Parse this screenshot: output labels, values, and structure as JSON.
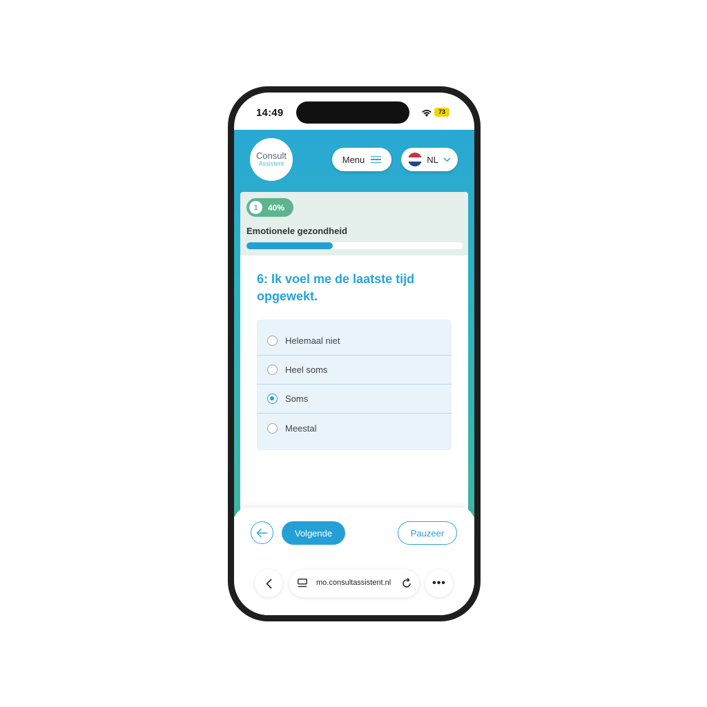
{
  "status_bar": {
    "time": "14:49",
    "battery": "73"
  },
  "header": {
    "logo_line1": "Consult",
    "logo_line2": "Assistent",
    "menu_label": "Menu",
    "language": "NL"
  },
  "progress": {
    "step": "1",
    "percent_label": "40%",
    "fraction": 0.4,
    "section_title": "Emotionele gezondheid"
  },
  "question": {
    "text": "6: Ik voel me de laatste tijd opgewekt.",
    "options": [
      {
        "label": "Helemaal niet",
        "selected": false
      },
      {
        "label": "Heel soms",
        "selected": false
      },
      {
        "label": "Soms",
        "selected": true
      },
      {
        "label": "Meestal",
        "selected": false
      }
    ]
  },
  "actions": {
    "next_label": "Volgende",
    "pause_label": "Pauzeer"
  },
  "browser": {
    "url": "mo.consultassistent.nl"
  },
  "colors": {
    "primary": "#24a0d6",
    "accent_green": "#5cb58e",
    "teal": "#2cb2c0"
  }
}
